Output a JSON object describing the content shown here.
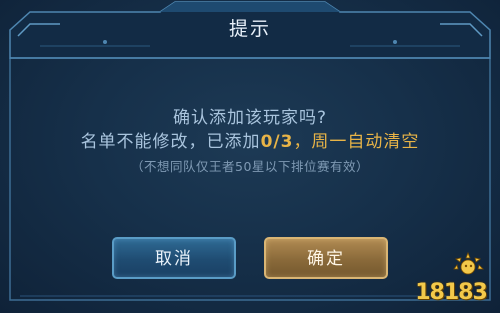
{
  "dialog": {
    "title": "提示",
    "message_line1": "确认添加该玩家吗?",
    "message_line2_prefix": "名单不能修改，已添加",
    "message_line2_count": "0/3",
    "message_line2_suffix": "，周一自动清空",
    "message_note": "（不想同队仅王者50星以下排位赛有效）",
    "cancel_label": "取消",
    "confirm_label": "确定"
  },
  "watermark": {
    "text": "18183"
  },
  "colors": {
    "background": "#16304a",
    "highlight": "#e8b447",
    "cancel_button": "#1f4c72",
    "confirm_button": "#8a6a3a"
  }
}
